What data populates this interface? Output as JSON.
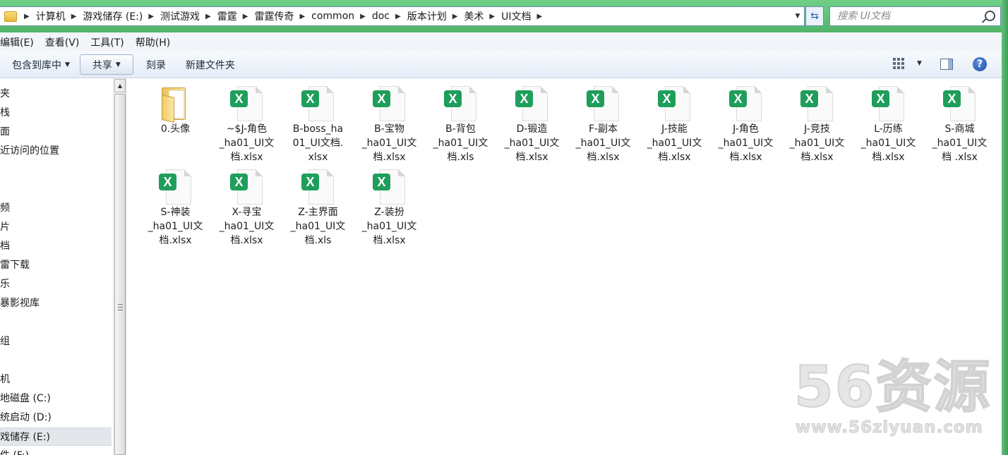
{
  "address": {
    "crumbs": [
      "计算机",
      "游戏储存 (E:)",
      "测试游戏",
      "雷霆",
      "雷霆传奇",
      "common",
      "doc",
      "版本计划",
      "美术",
      "UI文档"
    ]
  },
  "search": {
    "placeholder": "搜索 UI文档"
  },
  "menu": [
    "编辑(E)",
    "查看(V)",
    "工具(T)",
    "帮助(H)"
  ],
  "toolbar": {
    "include_library": "包含到库中",
    "share": "共享",
    "burn": "刻录",
    "new_folder": "新建文件夹"
  },
  "nav": [
    "夹",
    "栈",
    "面",
    "近访问的位置",
    "",
    "",
    "频",
    "片",
    "档",
    "雷下载",
    "乐",
    "暴影视库",
    "",
    "组",
    "",
    "机",
    "地磁盘 (C:)",
    "统启动 (D:)",
    "戏储存 (E:)",
    "件 (F:)"
  ],
  "files": [
    {
      "type": "folder",
      "label": "0.头像"
    },
    {
      "type": "xlsx",
      "label": "~$J-角色\n_ha01_UI文\n档.xlsx"
    },
    {
      "type": "xlsx",
      "label": "B-boss_ha\n01_UI文档.\nxlsx"
    },
    {
      "type": "xlsx",
      "label": "B-宝物\n_ha01_UI文\n档.xlsx"
    },
    {
      "type": "xlsx",
      "label": "B-背包\n_ha01_UI文\n档.xls"
    },
    {
      "type": "xlsx",
      "label": "D-锻造\n_ha01_UI文\n档.xlsx"
    },
    {
      "type": "xlsx",
      "label": "F-副本\n_ha01_UI文\n档.xlsx"
    },
    {
      "type": "xlsx",
      "label": "J-技能\n_ha01_UI文\n档.xlsx"
    },
    {
      "type": "xlsx",
      "label": "J-角色\n_ha01_UI文\n档.xlsx"
    },
    {
      "type": "xlsx",
      "label": "J-竞技\n_ha01_UI文\n档.xlsx"
    },
    {
      "type": "xlsx",
      "label": "L-历练\n_ha01_UI文\n档.xlsx"
    },
    {
      "type": "xlsx",
      "label": "S-商城\n_ha01_UI文\n档 .xlsx"
    },
    {
      "type": "xlsx",
      "label": "S-神装\n_ha01_UI文\n档.xlsx"
    },
    {
      "type": "xlsx",
      "label": "X-寻宝\n_ha01_UI文\n档.xlsx"
    },
    {
      "type": "xlsx",
      "label": "Z-主界面\n_ha01_UI文\n档.xls"
    },
    {
      "type": "xlsx",
      "label": "Z-装扮\n_ha01_UI文\n档.xlsx"
    }
  ],
  "watermark": {
    "big": "56资源",
    "url": "www.56ziyuan.com"
  },
  "colors": {
    "titlebar_green": "#5fc27a",
    "excel_green": "#1f9e5b",
    "selection_gray": "#e3e6ea"
  }
}
